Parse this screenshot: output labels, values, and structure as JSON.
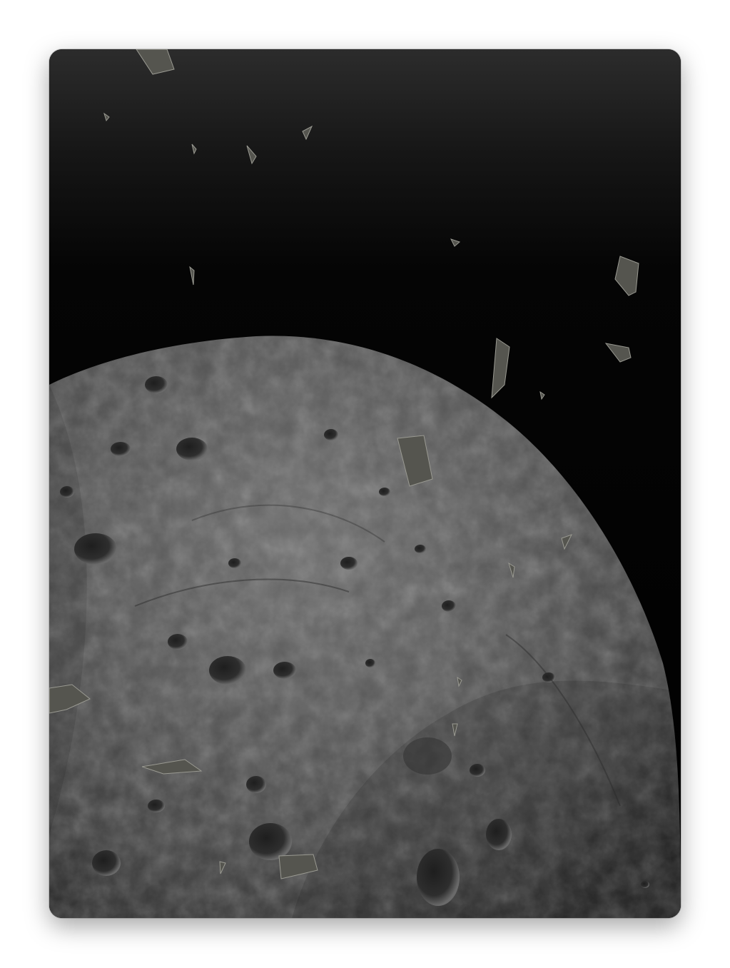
{
  "scene": {
    "subject": "asteroid",
    "background": "space",
    "debris_fragments": 20,
    "colors": {
      "space_top": "#2b2b2b",
      "space_bottom": "#000000",
      "rock_light": "#6a6a6a",
      "rock_mid": "#4a4a4a",
      "rock_dark": "#2a2a2a",
      "fragment": "#5a5a52"
    }
  }
}
